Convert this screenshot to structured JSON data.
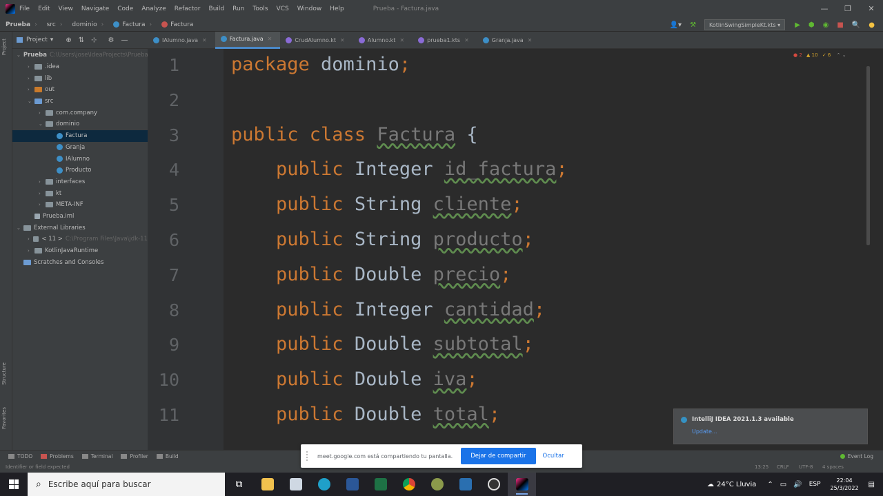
{
  "menubar": {
    "items": [
      "File",
      "Edit",
      "View",
      "Navigate",
      "Code",
      "Analyze",
      "Refactor",
      "Build",
      "Run",
      "Tools",
      "VCS",
      "Window",
      "Help"
    ],
    "title": "Prueba - Factura.java"
  },
  "navbar": {
    "crumbs": [
      "Prueba",
      "src",
      "dominio",
      "Factura",
      "Factura"
    ],
    "run_config": "KotlinSwingSimpleKt.kts"
  },
  "project_panel": {
    "label": "Project"
  },
  "tabs": [
    {
      "label": "IAlumno.java",
      "active": false
    },
    {
      "label": "Factura.java",
      "active": true
    },
    {
      "label": "CrudAlumno.kt",
      "active": false
    },
    {
      "label": "Alumno.kt",
      "active": false
    },
    {
      "label": "prueba1.kts",
      "active": false
    },
    {
      "label": "Granja.java",
      "active": false
    }
  ],
  "tree": [
    {
      "label": "Prueba",
      "extra": "C:\\Users\\jose\\IdeaProjects\\Prueba",
      "indent": 0,
      "arrow": "v",
      "icon": "folder-blue",
      "bold": true
    },
    {
      "label": ".idea",
      "indent": 1,
      "arrow": ">",
      "icon": "folder"
    },
    {
      "label": "lib",
      "indent": 1,
      "arrow": ">",
      "icon": "folder"
    },
    {
      "label": "out",
      "indent": 1,
      "arrow": ">",
      "icon": "folder-orange"
    },
    {
      "label": "src",
      "indent": 1,
      "arrow": "v",
      "icon": "folder-blue"
    },
    {
      "label": "com.company",
      "indent": 2,
      "arrow": ">",
      "icon": "folder"
    },
    {
      "label": "dominio",
      "indent": 2,
      "arrow": "v",
      "icon": "folder"
    },
    {
      "label": "Factura",
      "indent": 3,
      "arrow": "",
      "icon": "class",
      "selected": true
    },
    {
      "label": "Granja",
      "indent": 3,
      "arrow": "",
      "icon": "class"
    },
    {
      "label": "IAlumno",
      "indent": 3,
      "arrow": "",
      "icon": "class"
    },
    {
      "label": "Producto",
      "indent": 3,
      "arrow": "",
      "icon": "class"
    },
    {
      "label": "interfaces",
      "indent": 2,
      "arrow": ">",
      "icon": "folder"
    },
    {
      "label": "kt",
      "indent": 2,
      "arrow": ">",
      "icon": "folder"
    },
    {
      "label": "META-INF",
      "indent": 2,
      "arrow": ">",
      "icon": "folder"
    },
    {
      "label": "Prueba.iml",
      "indent": 1,
      "arrow": "",
      "icon": "file"
    },
    {
      "label": "External Libraries",
      "indent": 0,
      "arrow": "v",
      "icon": "folder"
    },
    {
      "label": "< 11 >",
      "extra": "C:\\Program Files\\Java\\jdk-11",
      "indent": 1,
      "arrow": ">",
      "icon": "folder"
    },
    {
      "label": "KotlinJavaRuntime",
      "indent": 1,
      "arrow": ">",
      "icon": "folder"
    },
    {
      "label": "Scratches and Consoles",
      "indent": 0,
      "arrow": "",
      "icon": "folder-blue"
    }
  ],
  "editor": {
    "line_numbers": [
      "1",
      "2",
      "3",
      "4",
      "5",
      "6",
      "7",
      "8",
      "9",
      "10",
      "11"
    ],
    "lines": [
      {
        "kw": "package ",
        "type": "",
        "name": "dominio",
        "end": ";"
      },
      {
        "kw": "",
        "type": "",
        "name": "",
        "end": ""
      },
      {
        "kw": "public class ",
        "type": "",
        "name": "Factura",
        "end": " {"
      },
      {
        "kw": "    public ",
        "type": "Integer ",
        "name": "id_factura",
        "end": ";"
      },
      {
        "kw": "    public ",
        "type": "String ",
        "name": "cliente",
        "end": ";"
      },
      {
        "kw": "    public ",
        "type": "String ",
        "name": "producto",
        "end": ";"
      },
      {
        "kw": "    public ",
        "type": "Double ",
        "name": "precio",
        "end": ";"
      },
      {
        "kw": "    public ",
        "type": "Integer ",
        "name": "cantidad",
        "end": ";"
      },
      {
        "kw": "    public ",
        "type": "Double ",
        "name": "subtotal",
        "end": ";"
      },
      {
        "kw": "    public ",
        "type": "Double ",
        "name": "iva",
        "end": ";"
      },
      {
        "kw": "    public ",
        "type": "Double ",
        "name": "total",
        "end": ";"
      }
    ],
    "inspections": {
      "errors": "2",
      "warnings": "10",
      "weak": "6"
    }
  },
  "bottom_tools": [
    "TODO",
    "Problems",
    "Terminal",
    "Profiler",
    "Build"
  ],
  "event_log": "Event Log",
  "status": {
    "message": "Identifier or field expected",
    "position": "13:25",
    "line_sep": "CRLF",
    "encoding": "UTF-8",
    "indent": "4 spaces"
  },
  "notification": {
    "title": "IntelliJ IDEA 2021.1.3 available",
    "link": "Update..."
  },
  "meet": {
    "message": "meet.google.com está compartiendo tu pantalla.",
    "stop_label": "Dejar de compartir",
    "hide_label": "Ocultar"
  },
  "taskbar": {
    "search_placeholder": "Escribe aquí para buscar",
    "weather": "24°C  Lluvia",
    "lang": "ESP",
    "time": "22:04",
    "date": "25/3/2022"
  },
  "colors": {
    "keyword": "#cc7832",
    "field": "#9876aa",
    "accent": "#4a88c7",
    "meet_blue": "#1a73e8"
  }
}
